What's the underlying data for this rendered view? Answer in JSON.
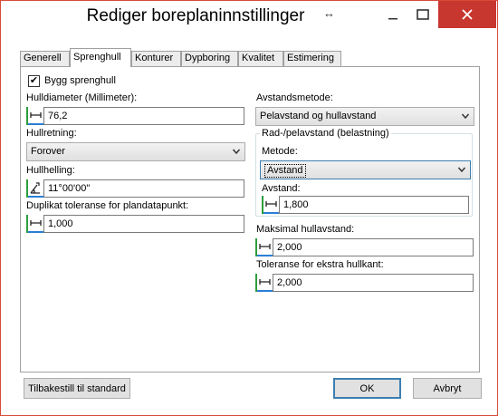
{
  "window": {
    "title": "Rediger boreplaninnstillinger",
    "title_glyph": "↔",
    "accent_close": "#c7372f",
    "frame_color": "#d94a3a"
  },
  "tabs": [
    {
      "label": "Generell",
      "active": false
    },
    {
      "label": "Sprenghull",
      "active": true
    },
    {
      "label": "Konturer",
      "active": false
    },
    {
      "label": "Dypboring",
      "active": false
    },
    {
      "label": "Kvalitet",
      "active": false
    },
    {
      "label": "Estimering",
      "active": false
    }
  ],
  "panel": {
    "build_checkbox": {
      "label": "Bygg sprenghull",
      "checked": true,
      "mark": "✔"
    },
    "hole_diameter": {
      "label": "Hulldiameter (Millimeter):",
      "value": "76,2",
      "icon": "length-unit-icon"
    },
    "hole_direction": {
      "label": "Hullretning:",
      "value": "Forover"
    },
    "hole_incline": {
      "label": "Hullhelling:",
      "value": "11°00'00\"",
      "icon": "angle-unit-icon"
    },
    "duplicate_tolerance": {
      "label": "Duplikat toleranse for plandatapunkt:",
      "value": "1,000",
      "icon": "length-unit-icon"
    },
    "distance_method": {
      "label": "Avstandsmetode:",
      "value": "Pelavstand og hullavstand"
    },
    "row_group": {
      "legend": "Rad-/pelavstand (belastning)",
      "method_label": "Metode:",
      "method_value": "Avstand",
      "distance_label": "Avstand:",
      "distance_value": "1,800"
    },
    "max_hole_distance": {
      "label": "Maksimal hullavstand:",
      "value": "2,000"
    },
    "edge_tolerance": {
      "label": "Toleranse for ekstra hullkant:",
      "value": "2,000"
    }
  },
  "footer": {
    "reset_label": "Tilbakestill til standard",
    "ok_label": "OK",
    "cancel_label": "Avbryt"
  }
}
